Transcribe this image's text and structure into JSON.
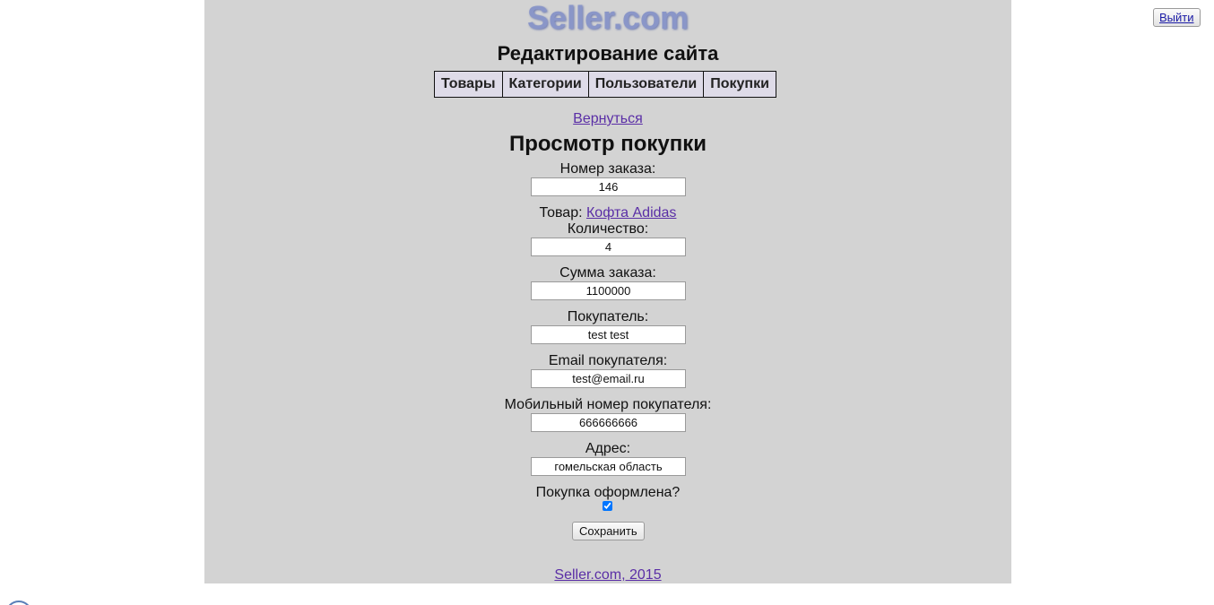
{
  "header": {
    "logo": "Seller.com",
    "site_title": "Редактирование сайта",
    "logout_label": "Выйти"
  },
  "nav": {
    "items": [
      {
        "label": "Товары"
      },
      {
        "label": "Категории"
      },
      {
        "label": "Пользователи"
      },
      {
        "label": "Покупки"
      }
    ]
  },
  "main": {
    "back_link": "Вернуться",
    "title": "Просмотр покупки",
    "order_number_label": "Номер заказа:",
    "order_number_value": "146",
    "product_label": "Товар:",
    "product_link": "Кофта Adidas",
    "quantity_label": "Количество:",
    "quantity_value": "4",
    "sum_label": "Сумма заказа:",
    "sum_value": "1100000",
    "buyer_label": "Покупатель:",
    "buyer_value": "test test",
    "email_label": "Email покупателя:",
    "email_value": "test@email.ru",
    "phone_label": "Мобильный номер покупателя:",
    "phone_value": "666666666",
    "address_label": "Адрес:",
    "address_value": "гомельская область",
    "completed_label": "Покупка оформлена?",
    "completed_checked": true,
    "save_label": "Сохранить"
  },
  "footer": {
    "text": "Seller.com, 2015"
  },
  "colors": {
    "content_bg": "#d3d3d3",
    "logo": "#8a96c8",
    "link": "#5a2ea6",
    "nav_bg": "#dedbe8"
  }
}
